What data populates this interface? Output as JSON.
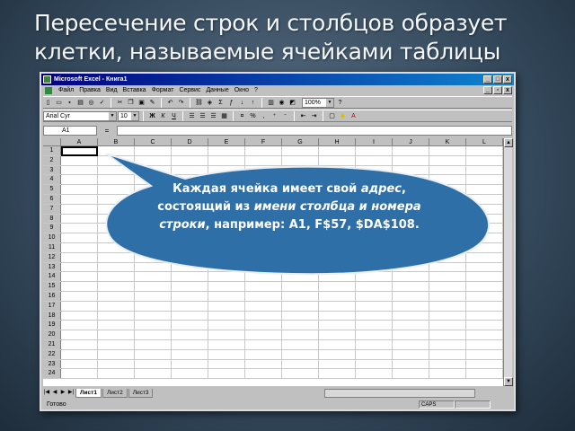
{
  "slide": {
    "title": "Пересечение строк и столбцов образует клетки, называемые ячейками таблицы"
  },
  "window": {
    "title": "Microsoft Excel - Книга1",
    "controls": [
      "_",
      "□",
      "x"
    ]
  },
  "menu": {
    "items": [
      "Файл",
      "Правка",
      "Вид",
      "Вставка",
      "Формат",
      "Сервис",
      "Данные",
      "Окно",
      "?"
    ]
  },
  "toolbar": {
    "zoom": "100%",
    "font": "Arial Cyr",
    "size": "10",
    "buttons": [
      "new-icon",
      "open-icon",
      "save-icon",
      "print-icon",
      "cut-icon",
      "copy-icon",
      "paste-icon",
      "undo-icon",
      "redo-icon",
      "sum-icon",
      "chart-icon",
      "help-icon"
    ],
    "format_labels": {
      "bold": "Ж",
      "italic": "К",
      "underline": "Ч",
      "percent": "%",
      "comma": ","
    }
  },
  "formula_bar": {
    "name_box": "A1",
    "fx": "="
  },
  "grid": {
    "columns": [
      "A",
      "B",
      "C",
      "D",
      "E",
      "F",
      "G",
      "H",
      "I",
      "J",
      "K",
      "L"
    ],
    "rows": [
      "1",
      "2",
      "3",
      "4",
      "5",
      "6",
      "7",
      "8",
      "9",
      "10",
      "11",
      "12",
      "13",
      "14",
      "15",
      "16",
      "17",
      "18",
      "19",
      "20",
      "21",
      "22",
      "23",
      "24"
    ]
  },
  "tabs": {
    "sheets": [
      "Лист1",
      "Лист2",
      "Лист3"
    ]
  },
  "status": {
    "text": "Готово",
    "caps": "CAPS"
  },
  "callout": {
    "part1": "Каждая ячейка имеет свой ",
    "part2": "адрес",
    "part3": ", состоящий из ",
    "part4": "имени столбца и номера строки",
    "part5": ", например: A1, F$57, $DA$108.",
    "fill": "#2f6fa8",
    "stroke": "#e8eef4"
  }
}
